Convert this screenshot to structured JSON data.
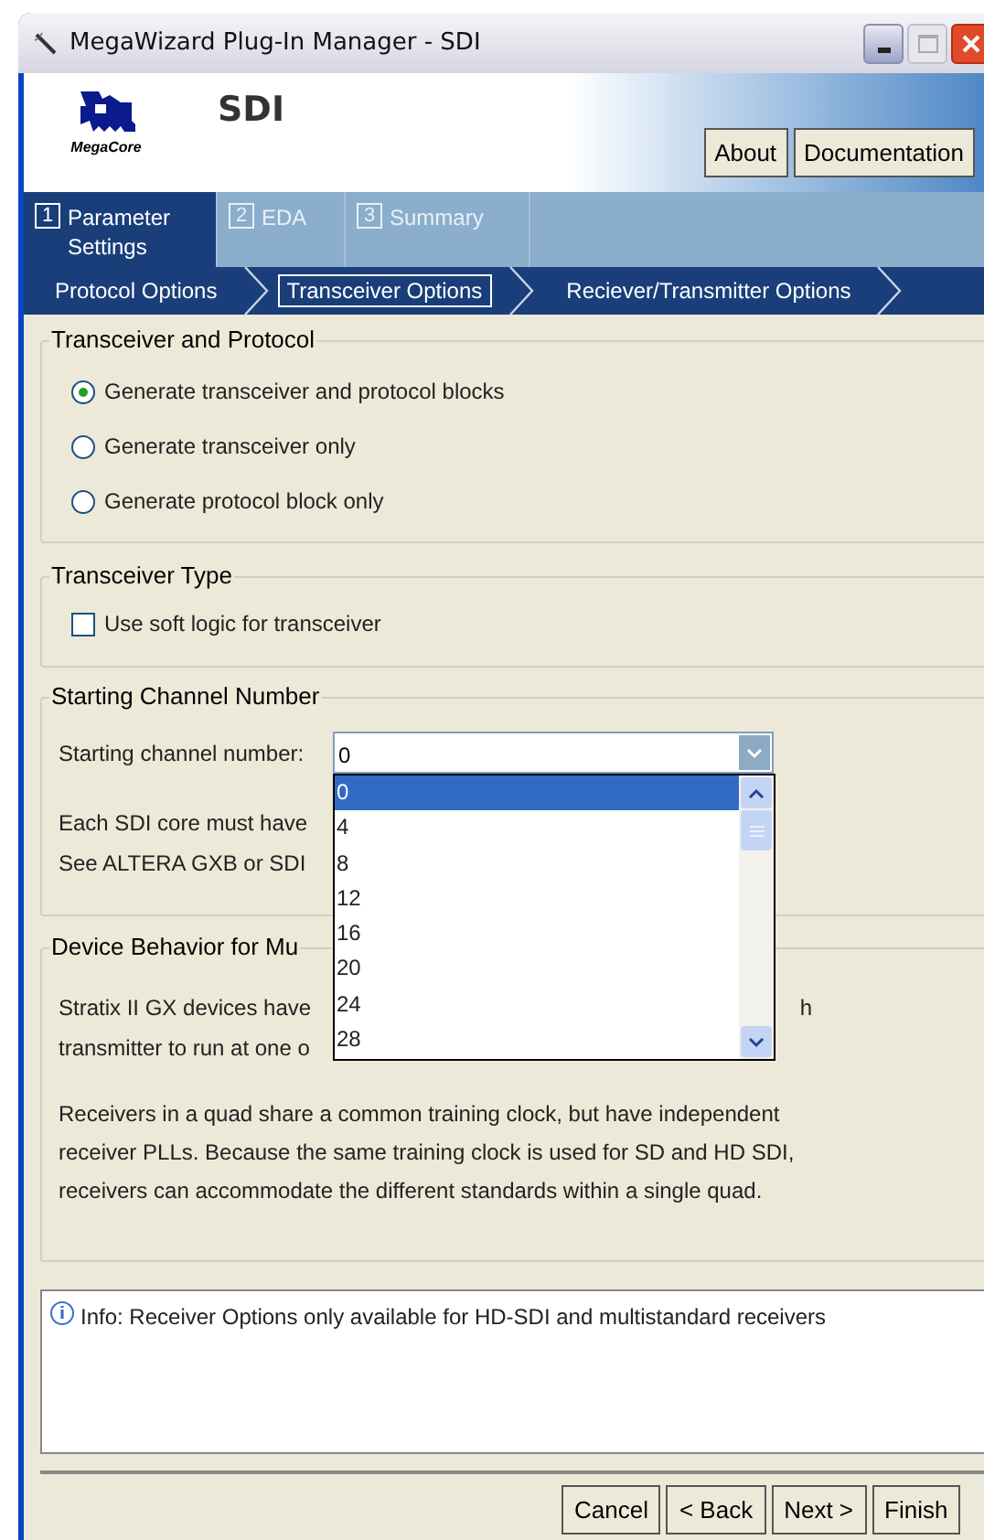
{
  "window": {
    "title": "MegaWizard Plug-In Manager - SDI"
  },
  "header": {
    "logo_text": "MegaCore",
    "title": "SDI",
    "buttons": [
      "About",
      "Documentation"
    ]
  },
  "tabs": [
    {
      "number": "1",
      "label": "Parameter Settings",
      "selected": true
    },
    {
      "number": "2",
      "label": "EDA",
      "selected": false
    },
    {
      "number": "3",
      "label": "Summary",
      "selected": false
    }
  ],
  "steps": [
    {
      "label": "Protocol Options",
      "selected": false
    },
    {
      "label": "Transceiver Options",
      "selected": true
    },
    {
      "label": "Reciever/Transmitter Options",
      "selected": false
    }
  ],
  "transceiver_and_protocol": {
    "title": "Transceiver and Protocol",
    "options": [
      {
        "label": "Generate transceiver and protocol blocks",
        "selected": true
      },
      {
        "label": "Generate transceiver only",
        "selected": false
      },
      {
        "label": "Generate protocol block only",
        "selected": false
      }
    ]
  },
  "transceiver_type": {
    "title": "Transceiver Type",
    "checkbox": {
      "label": "Use soft logic for transceiver",
      "checked": false
    }
  },
  "starting_channel": {
    "title": "Starting Channel Number",
    "label": "Starting channel number:",
    "value": "0",
    "notes": [
      "Each SDI core must have",
      "See ALTERA GXB or SDI"
    ],
    "dropdown": {
      "expanded": true,
      "options": [
        {
          "label": "0",
          "selected": true
        },
        {
          "label": "4",
          "selected": false
        },
        {
          "label": "8",
          "selected": false
        },
        {
          "label": "12",
          "selected": false
        },
        {
          "label": "16",
          "selected": false
        },
        {
          "label": "20",
          "selected": false
        },
        {
          "label": "24",
          "selected": false
        },
        {
          "label": "28",
          "selected": false
        }
      ]
    }
  },
  "device_behavior": {
    "title": "Device Behavior for Mu",
    "line_1": "Stratix II GX devices have",
    "line_1_end": "h",
    "line_2": "transmitter to run at one o",
    "paragraph": "Receivers in a quad share a common training clock, but have independent receiver PLLs. Because the same training clock is used for SD and HD SDI, receivers can accommodate the different standards within a single quad."
  },
  "info": {
    "message": "Info: Receiver Options only available for HD-SDI and multistandard receivers"
  },
  "buttons": [
    "Cancel",
    "< Back",
    "Next >",
    "Finish"
  ]
}
